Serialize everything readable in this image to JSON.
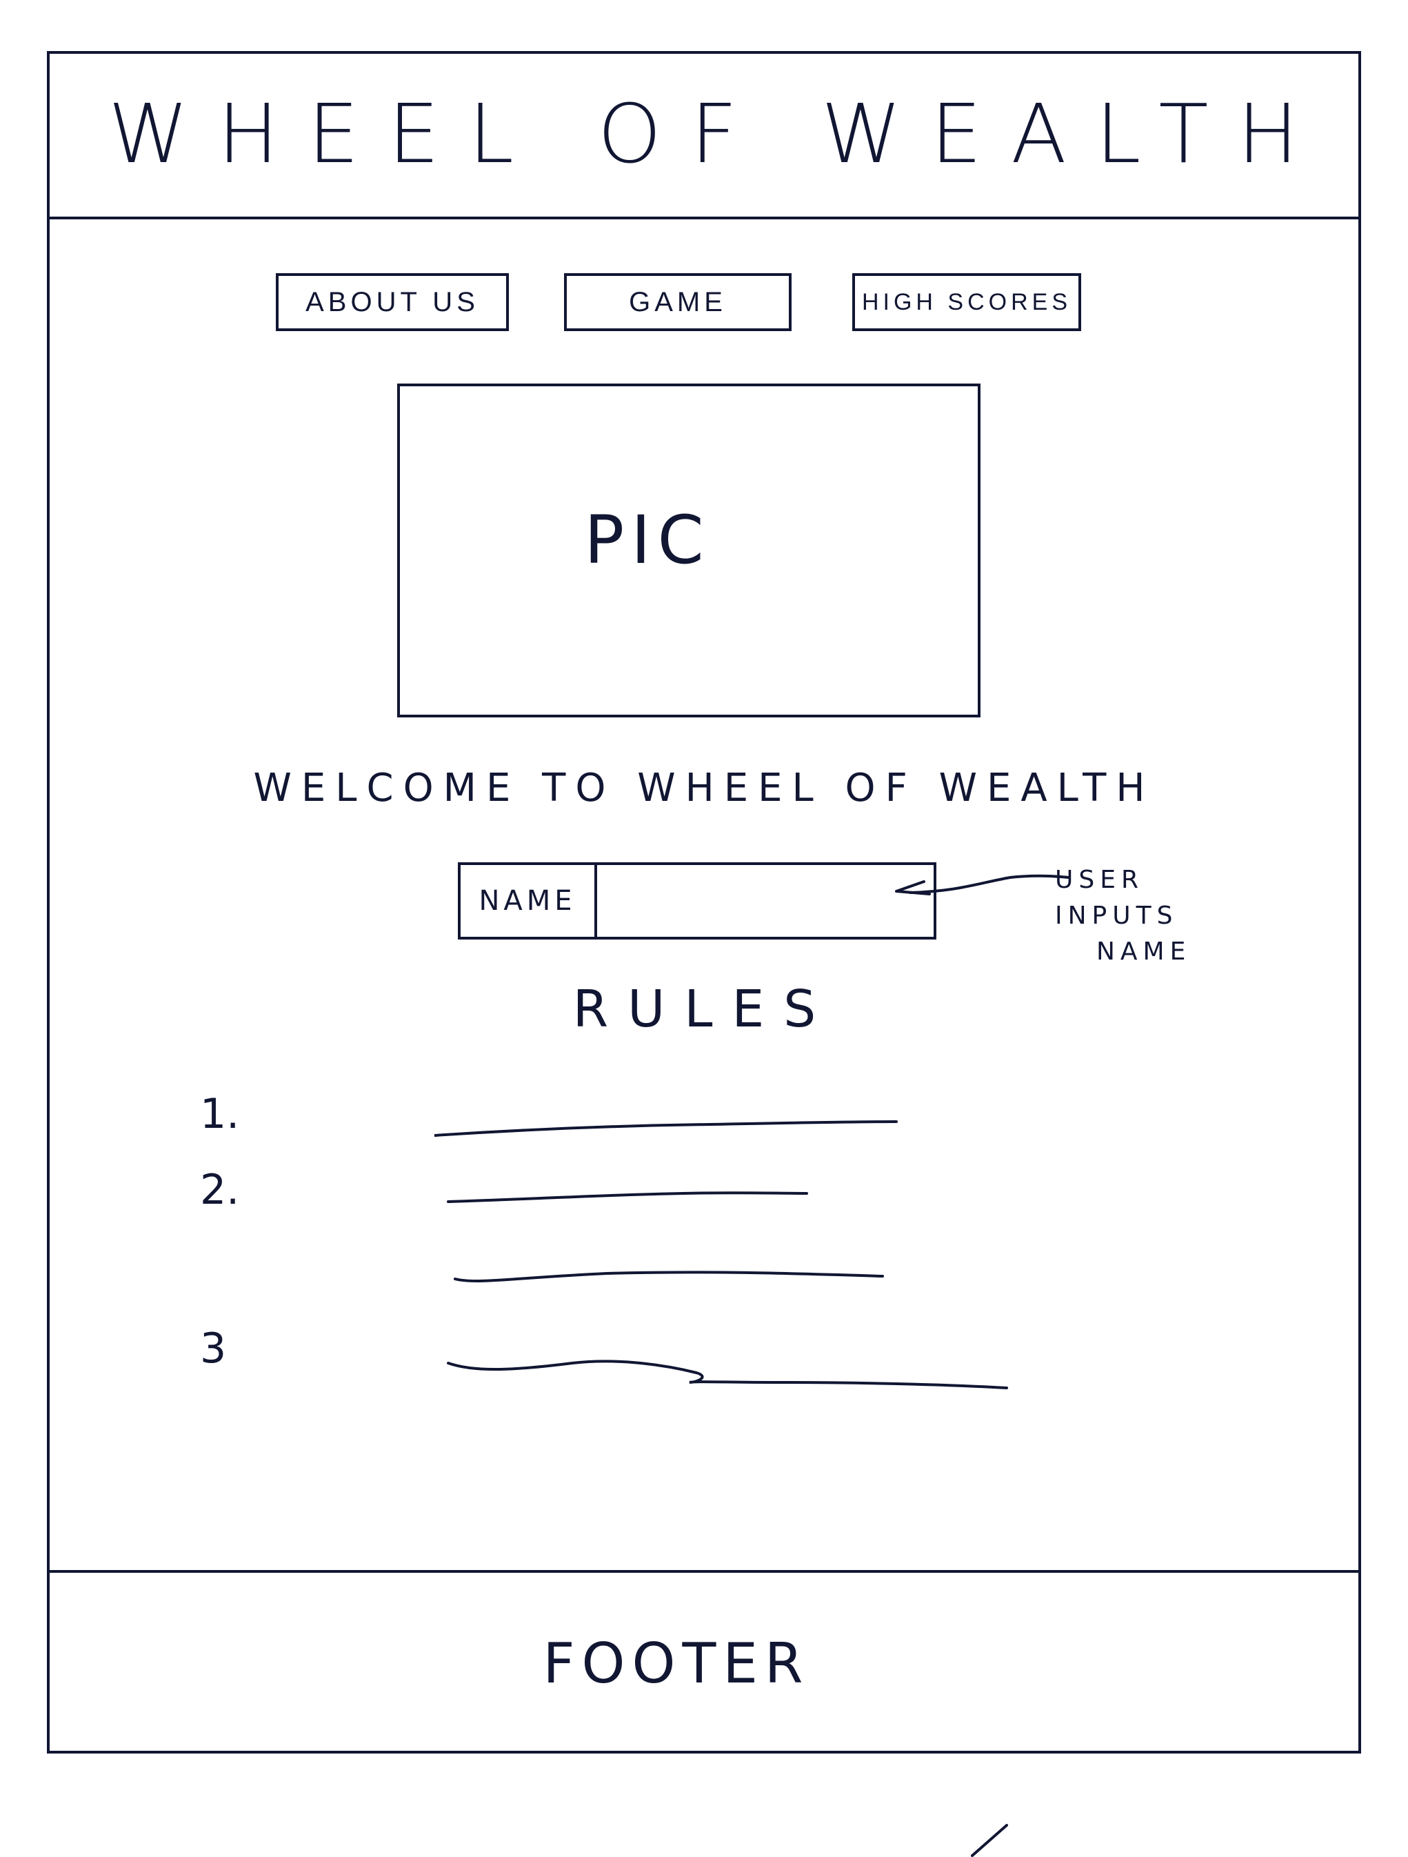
{
  "header": {
    "title": "WHEEL OF WEALTH"
  },
  "nav": {
    "about_label": "ABOUT US",
    "game_label": "GAME",
    "highscores_label": "HIGH SCORES"
  },
  "main": {
    "picture_label": "PIC",
    "welcome_text": "WELCOME TO WHEEL OF WEALTH",
    "name_field": {
      "label": "NAME",
      "value": ""
    },
    "annotation": [
      "USER",
      "INPUTS",
      "NAME"
    ],
    "rules": {
      "title": "RULES",
      "items": [
        {
          "number": "1."
        },
        {
          "number": "2."
        },
        {
          "number": "3"
        }
      ]
    }
  },
  "footer": {
    "text": "FOOTER"
  },
  "colors": {
    "ink": "#111633",
    "paper": "#ffffff"
  },
  "icons": {
    "annotation_arrow": "arrow-left-icon"
  }
}
